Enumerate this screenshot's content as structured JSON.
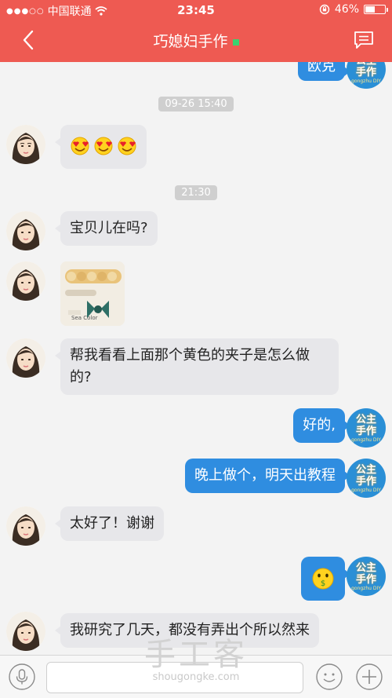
{
  "status_bar": {
    "carrier": "中国联通",
    "time": "23:45",
    "battery": "46%",
    "battery_level": 0.46
  },
  "header": {
    "title": "巧媳妇手作",
    "back_icon": "chevron-left-icon",
    "menu_icon": "chat-list-icon",
    "online_color": "#3bd16f"
  },
  "self_badge": {
    "line1": "公主",
    "line2": "手作",
    "small": "gongzhu DIY"
  },
  "messages": {
    "partial_top": "欧克",
    "time1": "09-26 15:40",
    "emoji_row": "heart-eyes-emoji x3",
    "time2": "21:30",
    "msg1": "宝贝儿在吗?",
    "image_caption": "Sea Color",
    "msg2_line1": "帮我看看上面那个黄色的夹子是怎么做",
    "msg2_line2": "的?",
    "reply1": "好的,",
    "reply2": "晚上做个，明天出教程",
    "msg3": "太好了！谢谢",
    "reply3_icon": "money-mouth-emoji",
    "msg4": "我研究了几天，都没有弄出个所以然来"
  },
  "footer": {
    "voice_icon": "microphone-icon",
    "emoji_icon": "smiley-icon",
    "add_icon": "plus-icon",
    "input_value": ""
  },
  "watermark": {
    "main": "手工客",
    "sub": "shougongke.com"
  },
  "colors": {
    "header": "#ee5a52",
    "bubble_left": "#e7e7ea",
    "bubble_right": "#2f8de0",
    "chat_bg": "#f3f3f3"
  }
}
